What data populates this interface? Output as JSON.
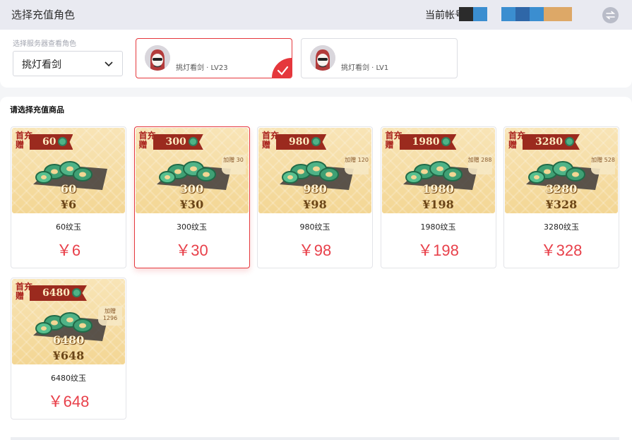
{
  "header": {
    "title": "选择充值角色",
    "account_label": "当前帐号",
    "swap_icon": "swap-icon"
  },
  "server": {
    "label": "选择服务器查看角色",
    "selected": "挑灯看剑"
  },
  "roles": [
    {
      "name": "挑灯看剑 · LV23",
      "selected": true
    },
    {
      "name": "挑灯看剑 · LV1",
      "selected": false
    }
  ],
  "products": {
    "heading": "请选择充值商品",
    "items": [
      {
        "first_badge": "首充赠",
        "ribbon": "60",
        "bonus": "",
        "amount": "60",
        "price_tag": "¥6",
        "name": "60纹玉",
        "price": "￥6",
        "selected": false
      },
      {
        "first_badge": "首充赠",
        "ribbon": "300",
        "bonus": "加赠 30",
        "amount": "300",
        "price_tag": "¥30",
        "name": "300纹玉",
        "price": "￥30",
        "selected": true
      },
      {
        "first_badge": "首充赠",
        "ribbon": "980",
        "bonus": "加赠 120",
        "amount": "980",
        "price_tag": "¥98",
        "name": "980纹玉",
        "price": "￥98",
        "selected": false
      },
      {
        "first_badge": "首充赠",
        "ribbon": "1980",
        "bonus": "加赠 288",
        "amount": "1980",
        "price_tag": "¥198",
        "name": "1980纹玉",
        "price": "￥198",
        "selected": false
      },
      {
        "first_badge": "首充赠",
        "ribbon": "3280",
        "bonus": "加赠 528",
        "amount": "3280",
        "price_tag": "¥328",
        "name": "3280纹玉",
        "price": "￥328",
        "selected": false
      },
      {
        "first_badge": "首充赠",
        "ribbon": "6480",
        "bonus": "加赠 1296",
        "amount": "6480",
        "price_tag": "¥648",
        "name": "6480纹玉",
        "price": "￥648",
        "selected": false
      }
    ]
  },
  "colors": {
    "accent": "#e5373c",
    "price": "#e8404a",
    "topbar": "#e9eaf1"
  }
}
